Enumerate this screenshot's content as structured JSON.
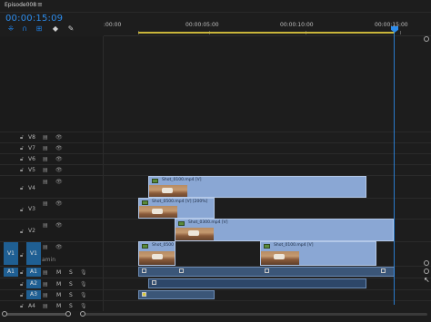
{
  "sequence": {
    "tab": "Episode008",
    "menu_icon": "hamburger-icon"
  },
  "timecode": "00:00:15:09",
  "tools": [
    "snap-icon",
    "linked-select-icon",
    "add-marker-icon",
    "marker-icon",
    "wrench-icon"
  ],
  "ruler": {
    "labels": [
      ":00:00",
      "00:00:05:00",
      "00:00:10:00",
      "00:00:15:00"
    ]
  },
  "video_tracks": [
    {
      "name": "V8"
    },
    {
      "name": "V7"
    },
    {
      "name": "V6"
    },
    {
      "name": "V5"
    },
    {
      "name": "V4"
    },
    {
      "name": "V3"
    },
    {
      "name": "V2"
    },
    {
      "name": "V1"
    }
  ],
  "audio_tracks": [
    {
      "name": "A1"
    },
    {
      "name": "A2"
    },
    {
      "name": "A3"
    },
    {
      "name": "A4"
    }
  ],
  "source_patch": {
    "v": "V1",
    "a": "A1"
  },
  "clips": {
    "v4": "Shot_0100.mp4 [V]",
    "v3": "Shot_0500.mp4 [V] [200%]",
    "v2": "Shot_0300.mp4 [V]",
    "v1a": "Shot_0500",
    "v1b": "Shot_0100.mp4 [V]"
  },
  "partial_text": "amin"
}
